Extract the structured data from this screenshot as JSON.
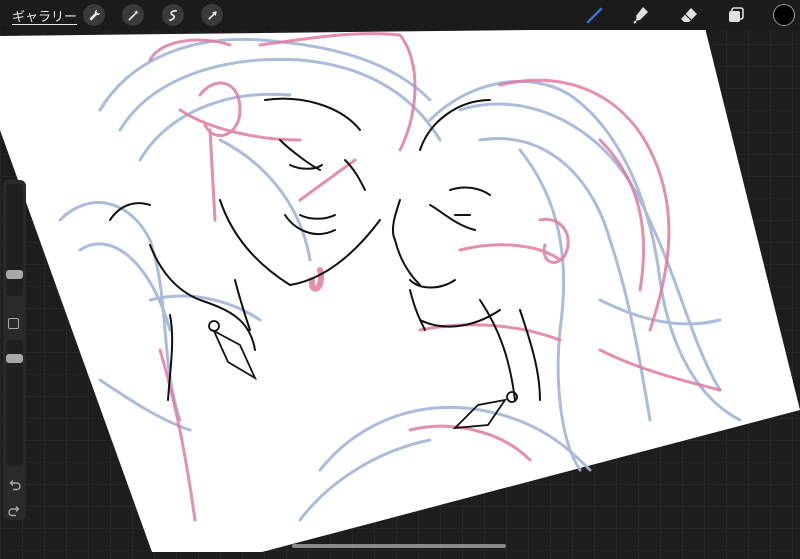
{
  "toolbar": {
    "gallery_label": "ギャラリー",
    "left_tools": [
      "wrench-icon",
      "magic-wand-icon",
      "selection-icon",
      "transform-arrow-icon"
    ],
    "right_tools": [
      "brush-icon",
      "smudge-icon",
      "eraser-icon",
      "layers-icon"
    ],
    "active_tool": "brush-icon",
    "active_tool_color": "#3b6fd6",
    "current_color": "#000000"
  },
  "sidebar": {
    "brush_size_level": 0.5,
    "opacity_level": 0.75,
    "modify_button": "square-icon",
    "undo": "undo-icon",
    "redo": "redo-icon"
  },
  "canvas": {
    "paper_color": "#ffffff",
    "sketch_colors": {
      "blue": "#a3b4d8",
      "pink": "#e07aa0",
      "ink": "#111111"
    }
  }
}
